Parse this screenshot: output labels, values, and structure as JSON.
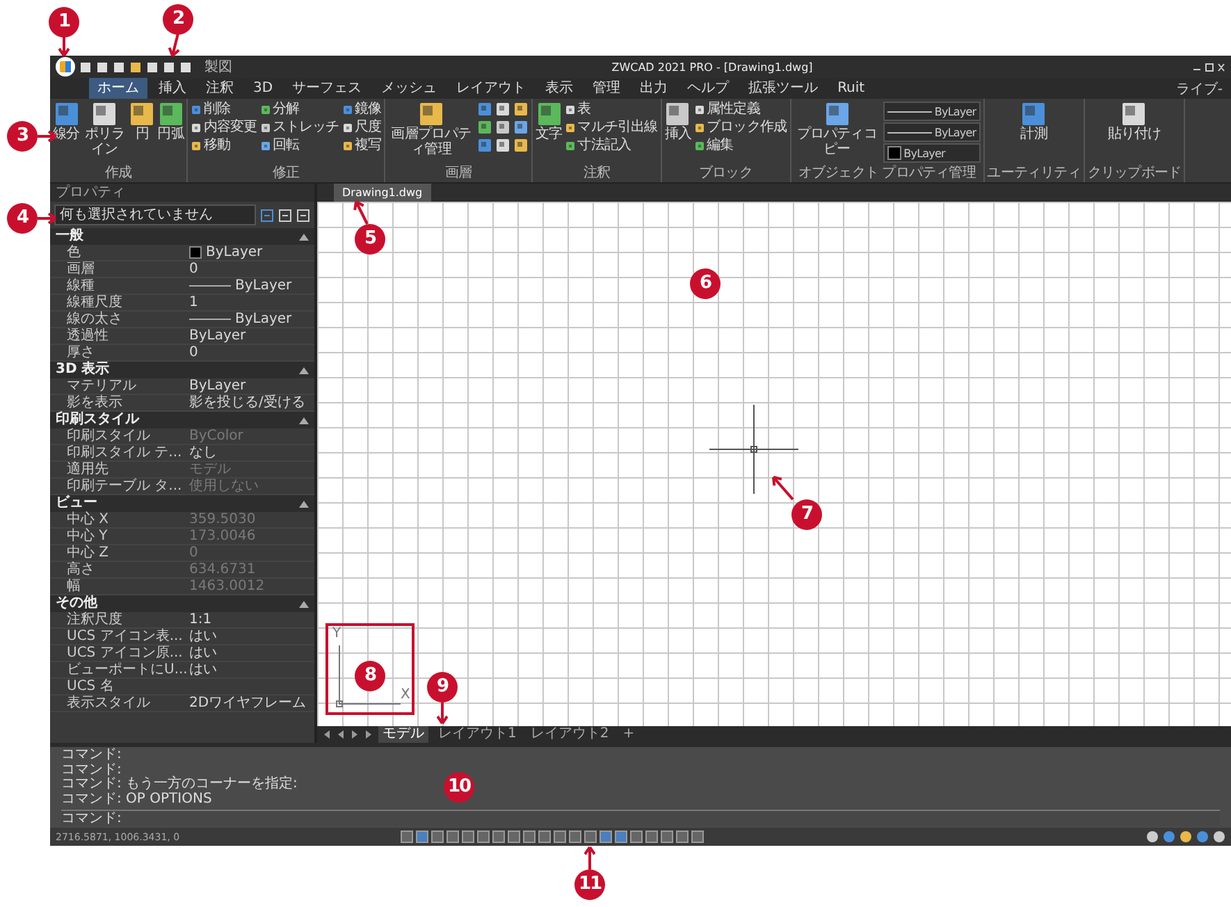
{
  "window": {
    "title": "ZWCAD 2021 PRO - [Drawing1.dwg]",
    "workspace": "ライブ-",
    "quick_workspace": "製図"
  },
  "menu_tabs": [
    {
      "label": "ホーム",
      "selected": true
    },
    {
      "label": "挿入",
      "selected": false
    },
    {
      "label": "注釈",
      "selected": false
    },
    {
      "label": "3D",
      "selected": false
    },
    {
      "label": "サーフェス",
      "selected": false
    },
    {
      "label": "メッシュ",
      "selected": false
    },
    {
      "label": "レイアウト",
      "selected": false
    },
    {
      "label": "表示",
      "selected": false
    },
    {
      "label": "管理",
      "selected": false
    },
    {
      "label": "出力",
      "selected": false
    },
    {
      "label": "ヘルプ",
      "selected": false
    },
    {
      "label": "拡張ツール",
      "selected": false
    },
    {
      "label": "Ruit",
      "selected": false
    }
  ],
  "ribbon": {
    "panels": [
      {
        "title": "作成",
        "tools": [
          {
            "kind": "large",
            "label": "線分"
          },
          {
            "kind": "large",
            "label": "ポリライン"
          },
          {
            "kind": "large",
            "label": "円"
          },
          {
            "kind": "large",
            "label": "円弧"
          }
        ]
      },
      {
        "title": "修正",
        "tools": [
          {
            "kind": "small",
            "label": "削除"
          },
          {
            "kind": "small",
            "label": "内容変更"
          },
          {
            "kind": "small",
            "label": "移動"
          },
          {
            "kind": "small",
            "label": "分解"
          },
          {
            "kind": "small",
            "label": "ストレッチ"
          },
          {
            "kind": "small",
            "label": "回転"
          },
          {
            "kind": "small",
            "label": "鏡像"
          },
          {
            "kind": "small",
            "label": "尺度"
          },
          {
            "kind": "small",
            "label": "複写"
          }
        ]
      },
      {
        "title": "画層",
        "tools": [
          {
            "kind": "large",
            "label": "画層プロパティ管理"
          },
          {
            "kind": "grid"
          }
        ]
      },
      {
        "title": "注釈",
        "tools": [
          {
            "kind": "large",
            "label": "文字"
          },
          {
            "kind": "small",
            "label": "表"
          },
          {
            "kind": "small",
            "label": "マルチ引出線"
          },
          {
            "kind": "small",
            "label": "寸法記入"
          }
        ]
      },
      {
        "title": "ブロック",
        "tools": [
          {
            "kind": "large",
            "label": "挿入"
          },
          {
            "kind": "small",
            "label": "属性定義"
          },
          {
            "kind": "small",
            "label": "ブロック作成"
          },
          {
            "kind": "small",
            "label": "編集"
          }
        ]
      },
      {
        "title": "オブジェクト プロパティ管理",
        "tools": [
          {
            "kind": "large",
            "label": "プロパティコピー"
          },
          {
            "kind": "line_row",
            "label": "ByLayer"
          },
          {
            "kind": "line_row",
            "label": "ByLayer"
          },
          {
            "kind": "color_row",
            "label": "ByLayer"
          }
        ]
      },
      {
        "title": "ユーティリティ",
        "tools": [
          {
            "kind": "large",
            "label": "計測"
          }
        ]
      },
      {
        "title": "クリップボード",
        "tools": [
          {
            "kind": "large",
            "label": "貼り付け"
          }
        ]
      }
    ]
  },
  "properties": {
    "title": "プロパティ",
    "selection": "何も選択されていません",
    "sections": [
      {
        "title": "一般",
        "rows": [
          {
            "kind": "swatch",
            "label": "色",
            "value": "ByLayer",
            "disabled": false
          },
          {
            "kind": "text",
            "label": "画層",
            "value": "0",
            "disabled": false
          },
          {
            "kind": "line",
            "label": "線種",
            "value": "ByLayer",
            "disabled": false
          },
          {
            "kind": "text",
            "label": "線種尺度",
            "value": "1",
            "disabled": false
          },
          {
            "kind": "line",
            "label": "線の太さ",
            "value": "ByLayer",
            "disabled": false
          },
          {
            "kind": "text",
            "label": "透過性",
            "value": "ByLayer",
            "disabled": false
          },
          {
            "kind": "text",
            "label": "厚さ",
            "value": "0",
            "disabled": false
          }
        ]
      },
      {
        "title": "3D 表示",
        "rows": [
          {
            "kind": "text",
            "label": "マテリアル",
            "value": "ByLayer",
            "disabled": false
          },
          {
            "kind": "text",
            "label": "影を表示",
            "value": "影を投じる/受ける",
            "disabled": false
          }
        ]
      },
      {
        "title": "印刷スタイル",
        "rows": [
          {
            "kind": "text",
            "label": "印刷スタイル",
            "value": "ByColor",
            "disabled": true
          },
          {
            "kind": "text",
            "label": "印刷スタイル テ...",
            "value": "なし",
            "disabled": false
          },
          {
            "kind": "text",
            "label": "適用先",
            "value": "モデル",
            "disabled": true
          },
          {
            "kind": "text",
            "label": "印刷テーブル タ...",
            "value": "使用しない",
            "disabled": true
          }
        ]
      },
      {
        "title": "ビュー",
        "rows": [
          {
            "kind": "text",
            "label": "中心 X",
            "value": "359.5030",
            "disabled": true
          },
          {
            "kind": "text",
            "label": "中心 Y",
            "value": "173.0046",
            "disabled": true
          },
          {
            "kind": "text",
            "label": "中心 Z",
            "value": "0",
            "disabled": true
          },
          {
            "kind": "text",
            "label": "高さ",
            "value": "634.6731",
            "disabled": true
          },
          {
            "kind": "text",
            "label": "幅",
            "value": "1463.0012",
            "disabled": true
          }
        ]
      },
      {
        "title": "その他",
        "rows": [
          {
            "kind": "text",
            "label": "注釈尺度",
            "value": "1:1",
            "disabled": false
          },
          {
            "kind": "text",
            "label": "UCS アイコン表...",
            "value": "はい",
            "disabled": false
          },
          {
            "kind": "text",
            "label": "UCS アイコン原...",
            "value": "はい",
            "disabled": false
          },
          {
            "kind": "text",
            "label": "ビューポートにU...",
            "value": "はい",
            "disabled": false
          },
          {
            "kind": "text",
            "label": "UCS 名",
            "value": ""
          },
          {
            "kind": "text",
            "label": "表示スタイル",
            "value": "2Dワイヤフレーム",
            "disabled": false
          }
        ]
      }
    ]
  },
  "document_tabs": [
    {
      "label": "Drawing1.dwg",
      "selected": true
    }
  ],
  "canvas": {
    "ucs": {
      "y": "Y",
      "x": "X"
    }
  },
  "layout_tabs": [
    {
      "label": "モデル",
      "selected": true
    },
    {
      "label": "レイアウト1",
      "selected": false
    },
    {
      "label": "レイアウト2",
      "selected": false
    }
  ],
  "add_layout": "+",
  "command": {
    "history": [
      "コマンド:",
      "コマンド:",
      "コマンド: もう一方のコーナーを指定:",
      "コマンド: OP OPTIONS"
    ],
    "prompt": "コマンド:"
  },
  "status_bar": {
    "coordinates": "2716.5871, 1006.3431, 0"
  },
  "callouts": [
    "1",
    "2",
    "3",
    "4",
    "5",
    "6",
    "7",
    "8",
    "9",
    "10",
    "11"
  ]
}
